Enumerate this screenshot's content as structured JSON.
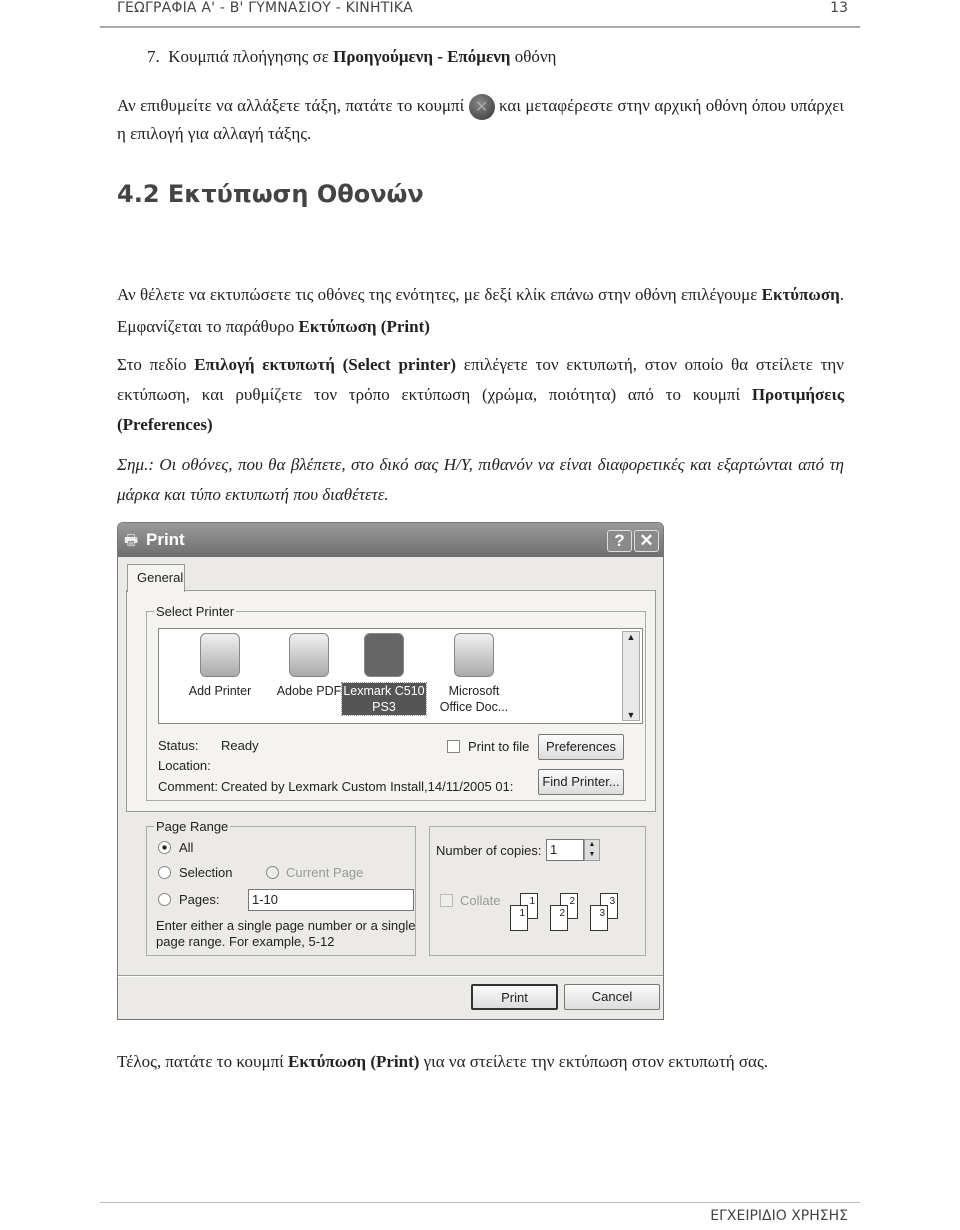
{
  "header": {
    "title": "ΓΕΩΓΡΑΦΙΑ Α' - Β' ΓΥΜΝΑΣΙΟΥ - ΚΙΝΗΤΙΚΑ",
    "page_number": "13"
  },
  "item7": {
    "number": "7.",
    "text1": "Κουμπιά πλοήγησης σε ",
    "bold": "Προηγούμενη - Επόμενη",
    "text2": " οθόνη"
  },
  "para1": {
    "text1": "Αν επιθυμείτε να αλλάξετε τάξη, πατάτε το κουμπί ",
    "icon": "close-nav-icon",
    "text2": " και μεταφέρεστε στην αρχική οθόνη όπου υπάρχει η επιλογή για αλλαγή τάξης."
  },
  "section": {
    "title": "4.2 Εκτύπωση Οθονών"
  },
  "para2": {
    "text1": "Αν θέλετε να εκτυπώσετε τις οθόνες της ενότητες, με δεξί κλίκ επάνω στην οθόνη επιλέγουμε ",
    "bold1": "Εκτύπωση",
    "text2": ". Εμφανίζεται το παράθυρο ",
    "bold2": "Εκτύπωση (Print)"
  },
  "para3": {
    "text1": "Στο πεδίο ",
    "bold1": "Επιλογή εκτυπωτή (Select printer)",
    "text2": " επιλέγετε τον εκτυπωτή, στον οποίο θα στείλετε την εκτύπωση, και ρυθμίζετε τον τρόπο εκτύπωση (χρώμα, ποιότητα) από το κουμπί ",
    "bold2": "Προτιμήσεις (Preferences)"
  },
  "note": {
    "label": "Σημ.",
    "text": ": Οι οθόνες, που θα βλέπετε, στο δικό σας Η/Υ, πιθανόν να είναι διαφορετικές και εξαρτώνται από τη μάρκα και τύπο εκτυπωτή που διαθέτετε."
  },
  "dialog": {
    "title": "Print",
    "help": "?",
    "close": "✕",
    "tab": "General",
    "select_printer": "Select Printer",
    "printers": [
      {
        "line1": "Add Printer",
        "line2": ""
      },
      {
        "line1": "Adobe PDF",
        "line2": ""
      },
      {
        "line1": "Lexmark C510",
        "line2": "PS3"
      },
      {
        "line1": "Microsoft",
        "line2": "Office Doc..."
      }
    ],
    "status_label": "Status:",
    "status": "Ready",
    "location_label": "Location:",
    "location": "",
    "comment_label": "Comment:",
    "comment": "Created by Lexmark Custom Install,14/11/2005 01:",
    "print_to_file": "Print to file",
    "preferences": "Preferences",
    "find_printer": "Find Printer...",
    "page_range": "Page Range",
    "all": "All",
    "selection": "Selection",
    "current_page": "Current Page",
    "pages": "Pages:",
    "pages_value": "1-10",
    "hint1": "Enter either a single page number or a single",
    "hint2": "page range.  For example, 5-12",
    "copies_label": "Number of copies:",
    "copies_value": "1",
    "collate": "Collate",
    "print": "Print",
    "cancel": "Cancel"
  },
  "final": {
    "text1": "Τέλος, πατάτε το κουμπί ",
    "bold": "Εκτύπωση (Print)",
    "text2": " για να στείλετε την εκτύπωση στον εκτυπωτή σας."
  },
  "footer": {
    "text": "ΕΓΧΕΙΡΙΔΙΟ ΧΡΗΣΗΣ"
  }
}
